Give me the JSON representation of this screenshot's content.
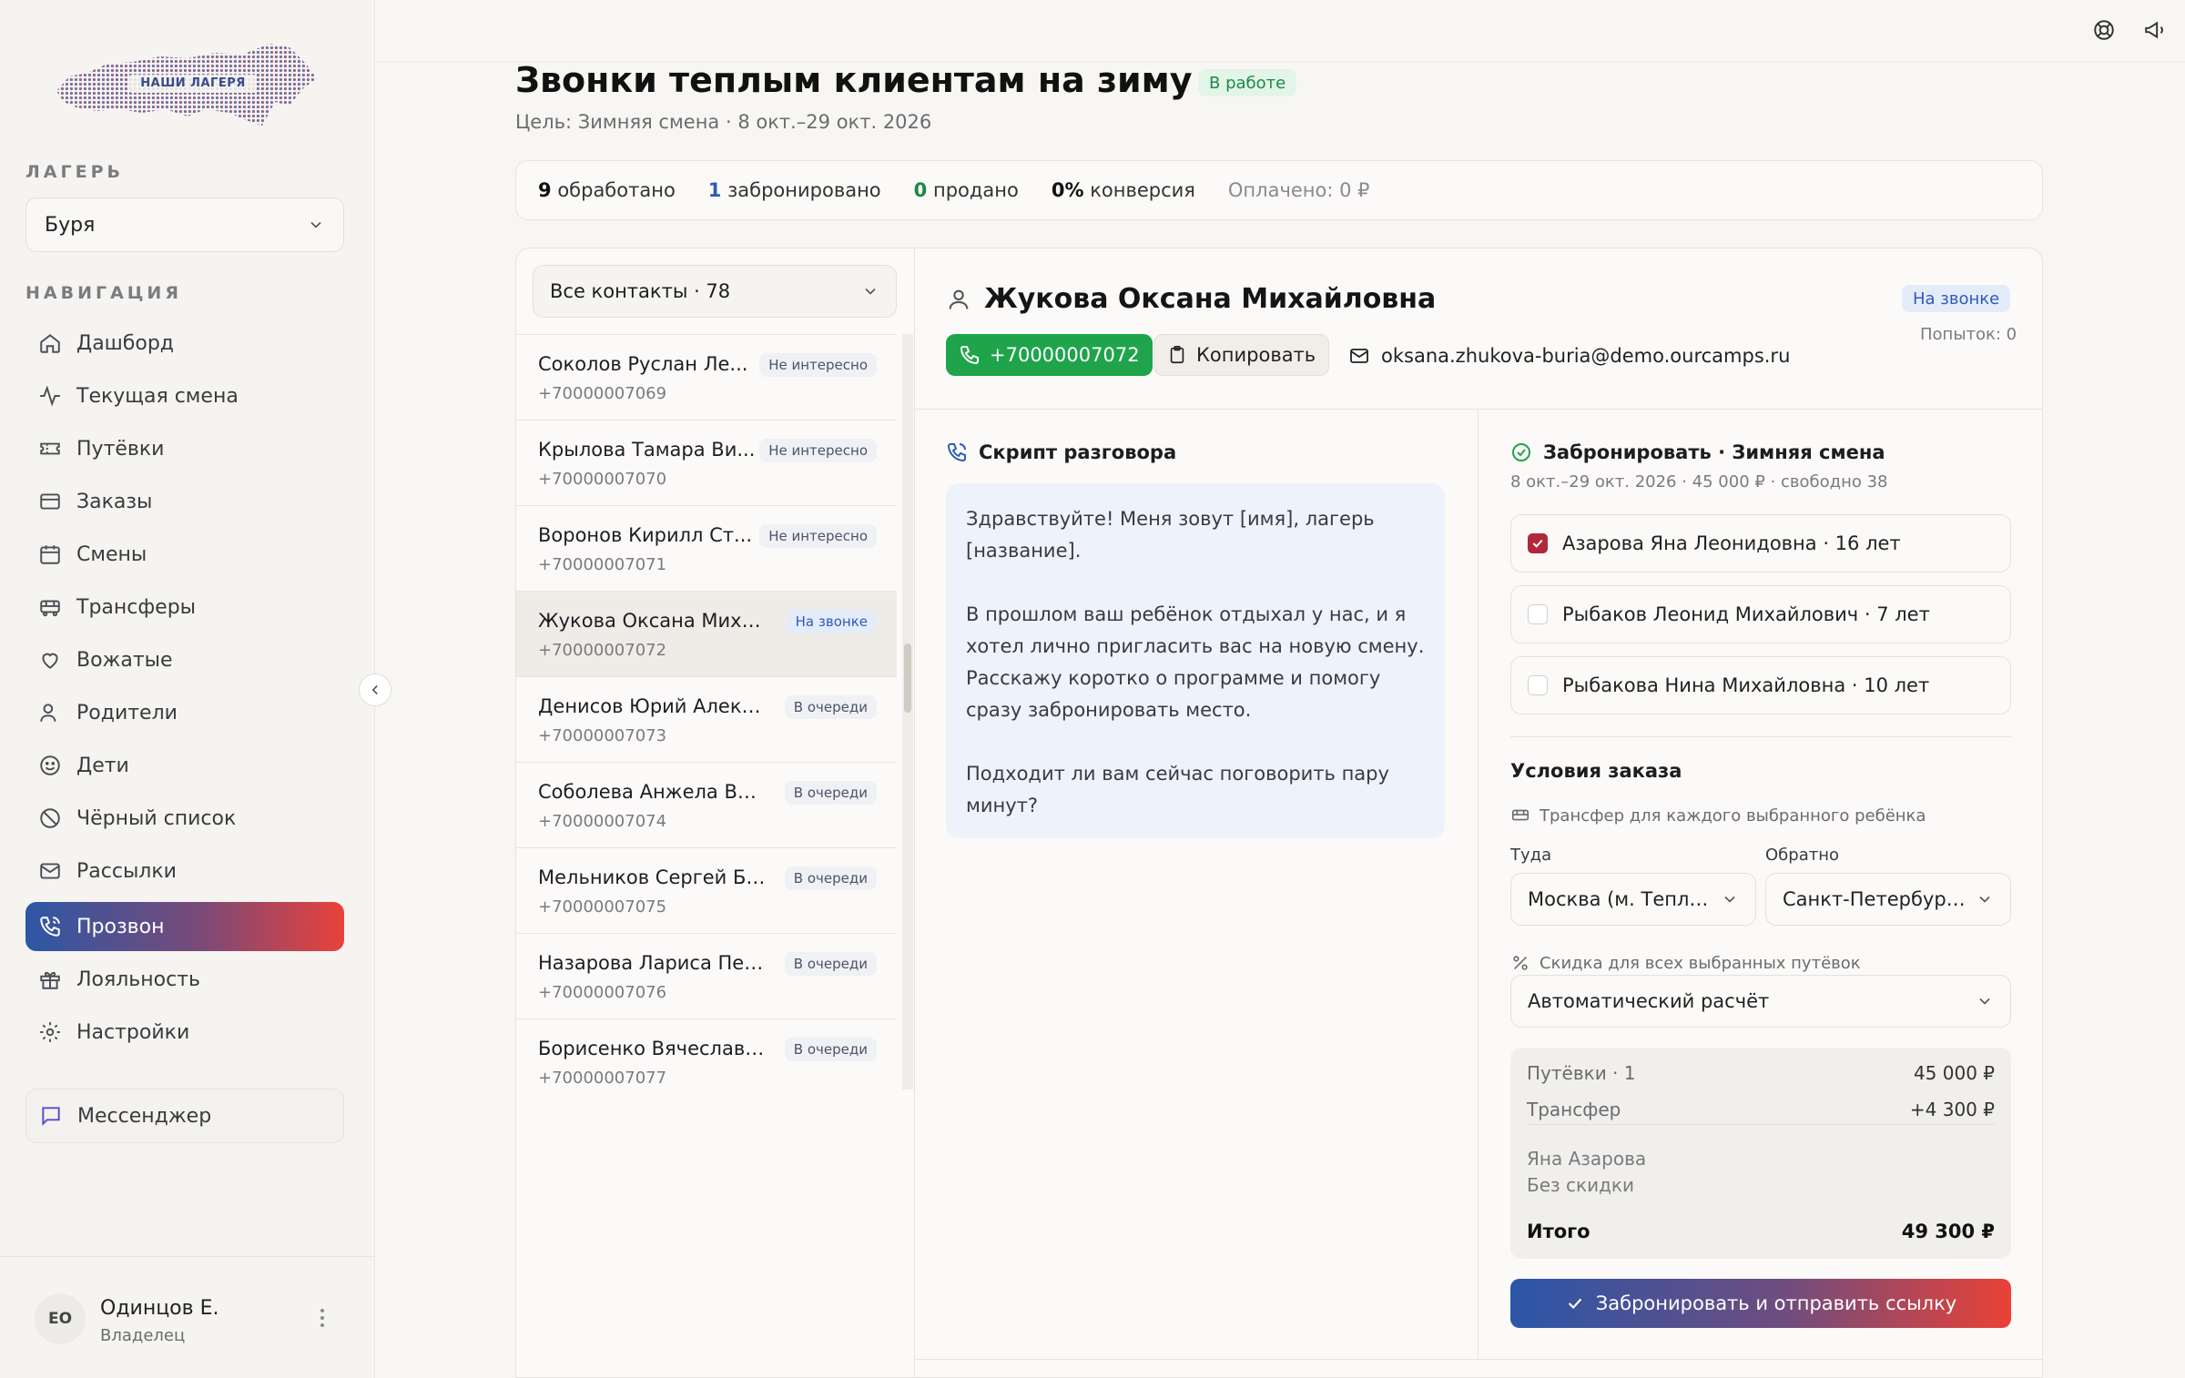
{
  "brand": {
    "logo_text": "НАШИ ЛАГЕРЯ"
  },
  "sidebar": {
    "camp_label": "ЛАГЕРЬ",
    "camp_value": "Буря",
    "nav_label": "НАВИГАЦИЯ",
    "items": [
      {
        "label": "Дашборд",
        "icon": "home-icon"
      },
      {
        "label": "Текущая смена",
        "icon": "activity-icon"
      },
      {
        "label": "Путёвки",
        "icon": "ticket-icon"
      },
      {
        "label": "Заказы",
        "icon": "card-icon"
      },
      {
        "label": "Смены",
        "icon": "calendar-icon"
      },
      {
        "label": "Трансферы",
        "icon": "bus-icon"
      },
      {
        "label": "Вожатые",
        "icon": "heart-hand-icon"
      },
      {
        "label": "Родители",
        "icon": "users-icon"
      },
      {
        "label": "Дети",
        "icon": "smile-icon"
      },
      {
        "label": "Чёрный список",
        "icon": "ban-icon"
      },
      {
        "label": "Рассылки",
        "icon": "mail-icon"
      },
      {
        "label": "Прозвон",
        "icon": "phone-icon",
        "active": true
      },
      {
        "label": "Лояльность",
        "icon": "gift-icon"
      },
      {
        "label": "Настройки",
        "icon": "gear-icon"
      }
    ],
    "messenger_label": "Мессенджер",
    "user": {
      "initials": "ЕО",
      "name": "Одинцов Е.",
      "role": "Владелец"
    }
  },
  "header": {
    "title": "Звонки теплым клиентам на зиму",
    "status": "В работе",
    "subtitle": "Цель: Зимняя смена · 8 окт.–29 окт. 2026"
  },
  "stats": {
    "processed_num": "9",
    "processed_label": "обработано",
    "booked_num": "1",
    "booked_label": "забронировано",
    "sold_num": "0",
    "sold_label": "продано",
    "conversion_num": "0%",
    "conversion_label": "конверсия",
    "paid": "Оплачено: 0 ₽"
  },
  "list": {
    "filter": "Все контакты · 78",
    "contacts": [
      {
        "name": "Соколов Руслан Ле...",
        "phone": "+70000007069",
        "badge": "Не интересно"
      },
      {
        "name": "Крылова Тамара Ви...",
        "phone": "+70000007070",
        "badge": "Не интересно"
      },
      {
        "name": "Воронов Кирилл Ст...",
        "phone": "+70000007071",
        "badge": "Не интересно"
      },
      {
        "name": "Жукова Оксана Михай...",
        "phone": "+70000007072",
        "badge": "На звонке",
        "active": true
      },
      {
        "name": "Денисов Юрий Алекс...",
        "phone": "+70000007073",
        "badge": "В очереди"
      },
      {
        "name": "Соболева Анжела Вяч...",
        "phone": "+70000007074",
        "badge": "В очереди"
      },
      {
        "name": "Мельников Сергей Бо...",
        "phone": "+70000007075",
        "badge": "В очереди"
      },
      {
        "name": "Назарова Лариса Пет...",
        "phone": "+70000007076",
        "badge": "В очереди"
      },
      {
        "name": "Борисенко Вячеслав Т...",
        "phone": "+70000007077",
        "badge": "В очереди"
      }
    ]
  },
  "detail": {
    "name": "Жукова Оксана Михайловна",
    "status": "На звонке",
    "attempts": "Попыток: 0",
    "phone": "+70000007072",
    "copy_label": "Копировать",
    "email": "oksana.zhukova-buria@demo.ourcamps.ru",
    "script_title": "Скрипт разговора",
    "script_p1": "Здравствуйте! Меня зовут [имя], лагерь [название].",
    "script_p2": "В прошлом ваш ребёнок отдыхал у нас, и я хотел лично пригласить вас на новую смену. Расскажу коротко о программе и помогу сразу забронировать место.",
    "script_p3": "Подходит ли вам сейчас поговорить пару минут?",
    "booking_title": "Забронировать · Зимняя смена",
    "booking_sub": "8 окт.–29 окт. 2026 · 45 000 ₽ · свободно 38",
    "children": [
      {
        "label": "Азарова Яна Леонидовна · 16 лет",
        "checked": true
      },
      {
        "label": "Рыбаков Леонид Михайлович · 7 лет",
        "checked": false
      },
      {
        "label": "Рыбакова Нина Михайловна · 10 лет",
        "checked": false
      }
    ],
    "terms_title": "Условия заказа",
    "transfer_note": "Трансфер для каждого выбранного ребёнка",
    "there_label": "Туда",
    "there_value": "Москва (м. Теплы...",
    "back_label": "Обратно",
    "back_value": "Санкт-Петербург...",
    "discount_note": "Скидка для всех выбранных путёвок",
    "discount_value": "Автоматический расчёт",
    "summary": {
      "vouchers_label": "Путёвки · 1",
      "vouchers_value": "45 000 ₽",
      "transfer_label": "Трансфер",
      "transfer_value": "+4 300 ₽",
      "child_name": "Яна Азарова",
      "child_discount": "Без скидки",
      "total_label": "Итого",
      "total_value": "49 300 ₽"
    },
    "book_button": "Забронировать и отправить ссылку"
  },
  "colors": {
    "accent_start": "#2b56a8",
    "accent_end": "#ea4136",
    "success": "#1fa44b",
    "info": "#2d5bb8"
  }
}
